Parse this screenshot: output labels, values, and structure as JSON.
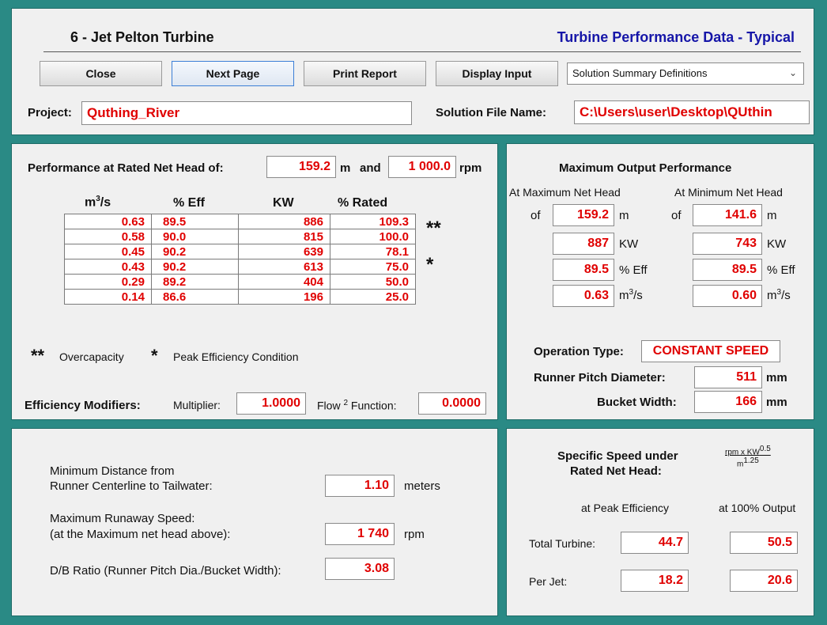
{
  "header": {
    "title": "6 - Jet Pelton Turbine",
    "subtitle": "Turbine Performance Data - Typical",
    "buttons": {
      "close": "Close",
      "next": "Next Page",
      "print": "Print Report",
      "display": "Display Input"
    },
    "dropdown_value": "Solution Summary Definitions",
    "project_label": "Project:",
    "project_value": "Quthing_River",
    "solution_label": "Solution File Name:",
    "solution_value": "C:\\Users\\user\\Desktop\\QUthin"
  },
  "performance": {
    "heading": "Performance at Rated Net Head of:",
    "head_value": "159.2",
    "head_unit": "m",
    "and": "and",
    "rpm_value": "1 000.0",
    "rpm_unit": "rpm",
    "columns": {
      "flow_base": "m",
      "flow_sup": "3",
      "flow_tail": "/s",
      "eff": "% Eff",
      "kw": "KW",
      "rated": "% Rated"
    },
    "rows": [
      [
        "0.63",
        "89.5",
        "886",
        "109.3"
      ],
      [
        "0.58",
        "90.0",
        "815",
        "100.0"
      ],
      [
        "0.45",
        "90.2",
        "639",
        "78.1"
      ],
      [
        "0.43",
        "90.2",
        "613",
        "75.0"
      ],
      [
        "0.29",
        "89.2",
        "404",
        "50.0"
      ],
      [
        "0.14",
        "86.6",
        "196",
        "25.0"
      ]
    ],
    "marker_double": "**",
    "marker_single": "*",
    "legend_double_text": "Overcapacity",
    "legend_single_text": "Peak Efficiency Condition",
    "modifiers_label": "Efficiency Modifiers:",
    "multiplier_label": "Multiplier:",
    "multiplier_value": "1.0000",
    "flow_label_base": "Flow",
    "flow_label_sup": "2",
    "flow_label_tail": "Function:",
    "flow_value": "0.0000"
  },
  "max_output": {
    "heading": "Maximum Output Performance",
    "col_max": "At Maximum Net Head",
    "col_min": "At Minimum Net Head",
    "of": "of",
    "max": {
      "head": "159.2",
      "kw": "887",
      "eff": "89.5",
      "flow": "0.63"
    },
    "min": {
      "head": "141.6",
      "kw": "743",
      "eff": "89.5",
      "flow": "0.60"
    },
    "unit_m": "m",
    "unit_kw": "KW",
    "unit_eff": "% Eff",
    "unit_flow_base": "m",
    "unit_flow_sup": "3",
    "unit_flow_tail": "/s",
    "op_type_label": "Operation Type:",
    "op_type_value": "CONSTANT SPEED",
    "pitch_label": "Runner Pitch Diameter:",
    "pitch_value": "511",
    "pitch_unit": "mm",
    "bucket_label": "Bucket Width:",
    "bucket_value": "166",
    "bucket_unit": "mm"
  },
  "lower_left": {
    "min_dist_line1": "Minimum Distance from",
    "min_dist_line2": "Runner Centerline to Tailwater:",
    "min_dist_value": "1.10",
    "min_dist_unit": "meters",
    "runaway_line1": "Maximum Runaway Speed:",
    "runaway_line2": "(at the Maximum net head above):",
    "runaway_value": "1 740",
    "runaway_unit": "rpm",
    "db_label": "D/B Ratio (Runner Pitch Dia./Bucket Width):",
    "db_value": "3.08"
  },
  "specific_speed": {
    "heading_line1": "Specific Speed under",
    "heading_line2": "Rated Net Head:",
    "formula_num": "rpm x KW",
    "formula_num_sup": "0.5",
    "formula_den": "m",
    "formula_den_sup": "1.25",
    "col_peak": "at Peak Efficiency",
    "col_100": "at 100% Output",
    "total_label": "Total Turbine:",
    "total_peak": "44.7",
    "total_100": "50.5",
    "jet_label": "Per Jet:",
    "jet_peak": "18.2",
    "jet_100": "20.6"
  }
}
